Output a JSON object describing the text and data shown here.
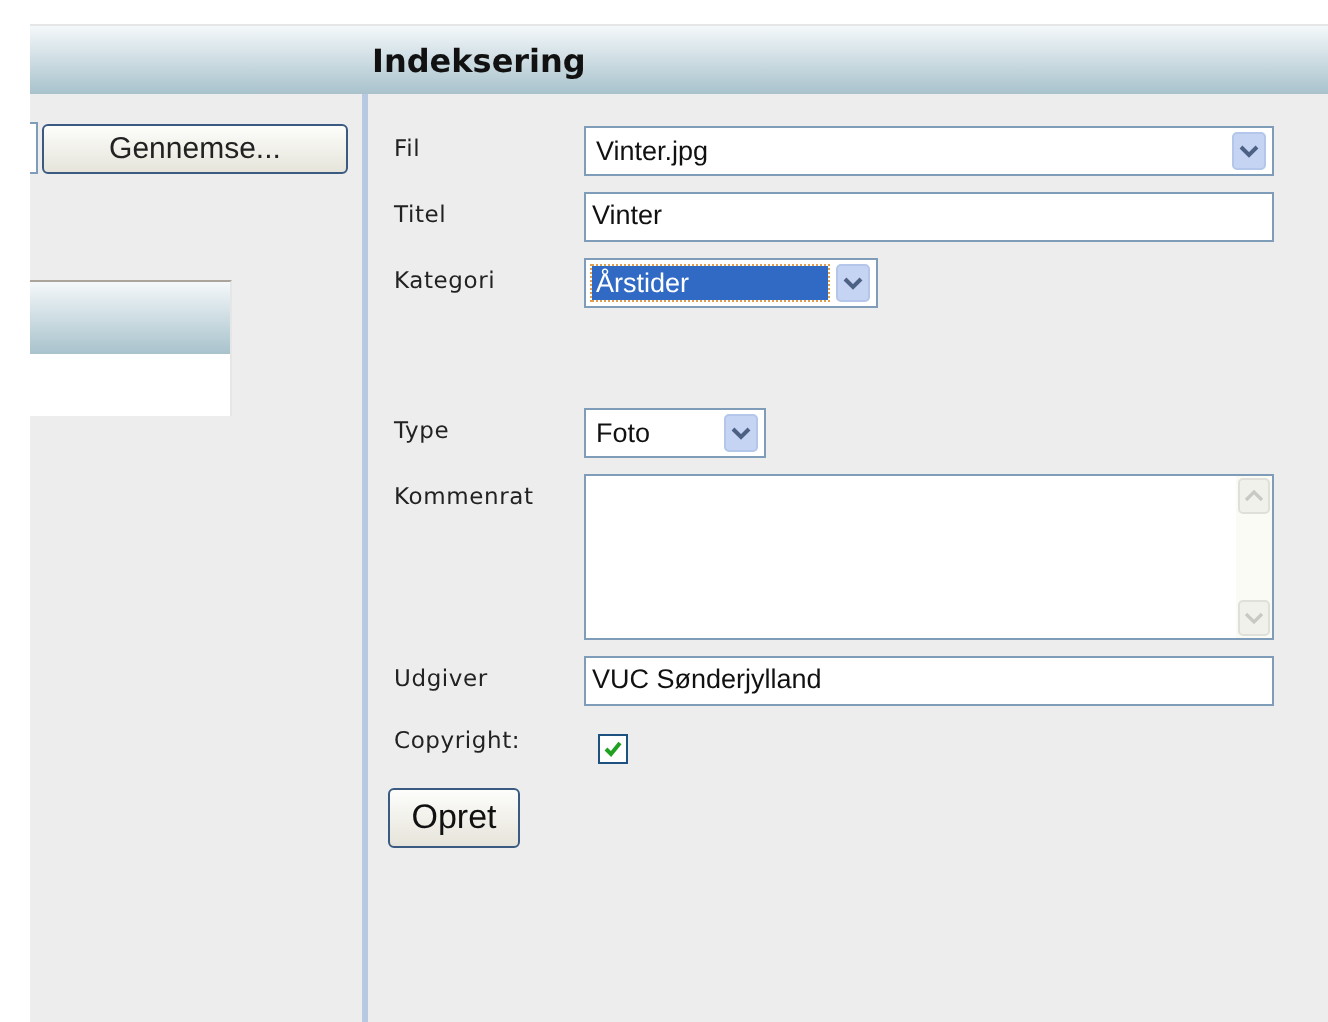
{
  "header": {
    "title": "Indeksering"
  },
  "left": {
    "browse_button": "Gennemse..."
  },
  "form": {
    "fields": [
      {
        "kind": "select",
        "label": "Fil",
        "value": "Vinter.jpg",
        "highlighted": false
      },
      {
        "kind": "text",
        "label": "Titel",
        "value": "Vinter"
      },
      {
        "kind": "select",
        "label": "Kategori",
        "value": "Årstider",
        "highlighted": true
      },
      {
        "kind": "select",
        "label": "Type",
        "value": "Foto",
        "highlighted": false
      },
      {
        "kind": "textarea",
        "label": "Kommenrat"
      },
      {
        "kind": "text",
        "label": "Udgiver",
        "value": "VUC Sønderjylland"
      },
      {
        "kind": "checkbox",
        "label": "Copyright:",
        "checked": true
      }
    ],
    "submit_button": "Opret"
  }
}
